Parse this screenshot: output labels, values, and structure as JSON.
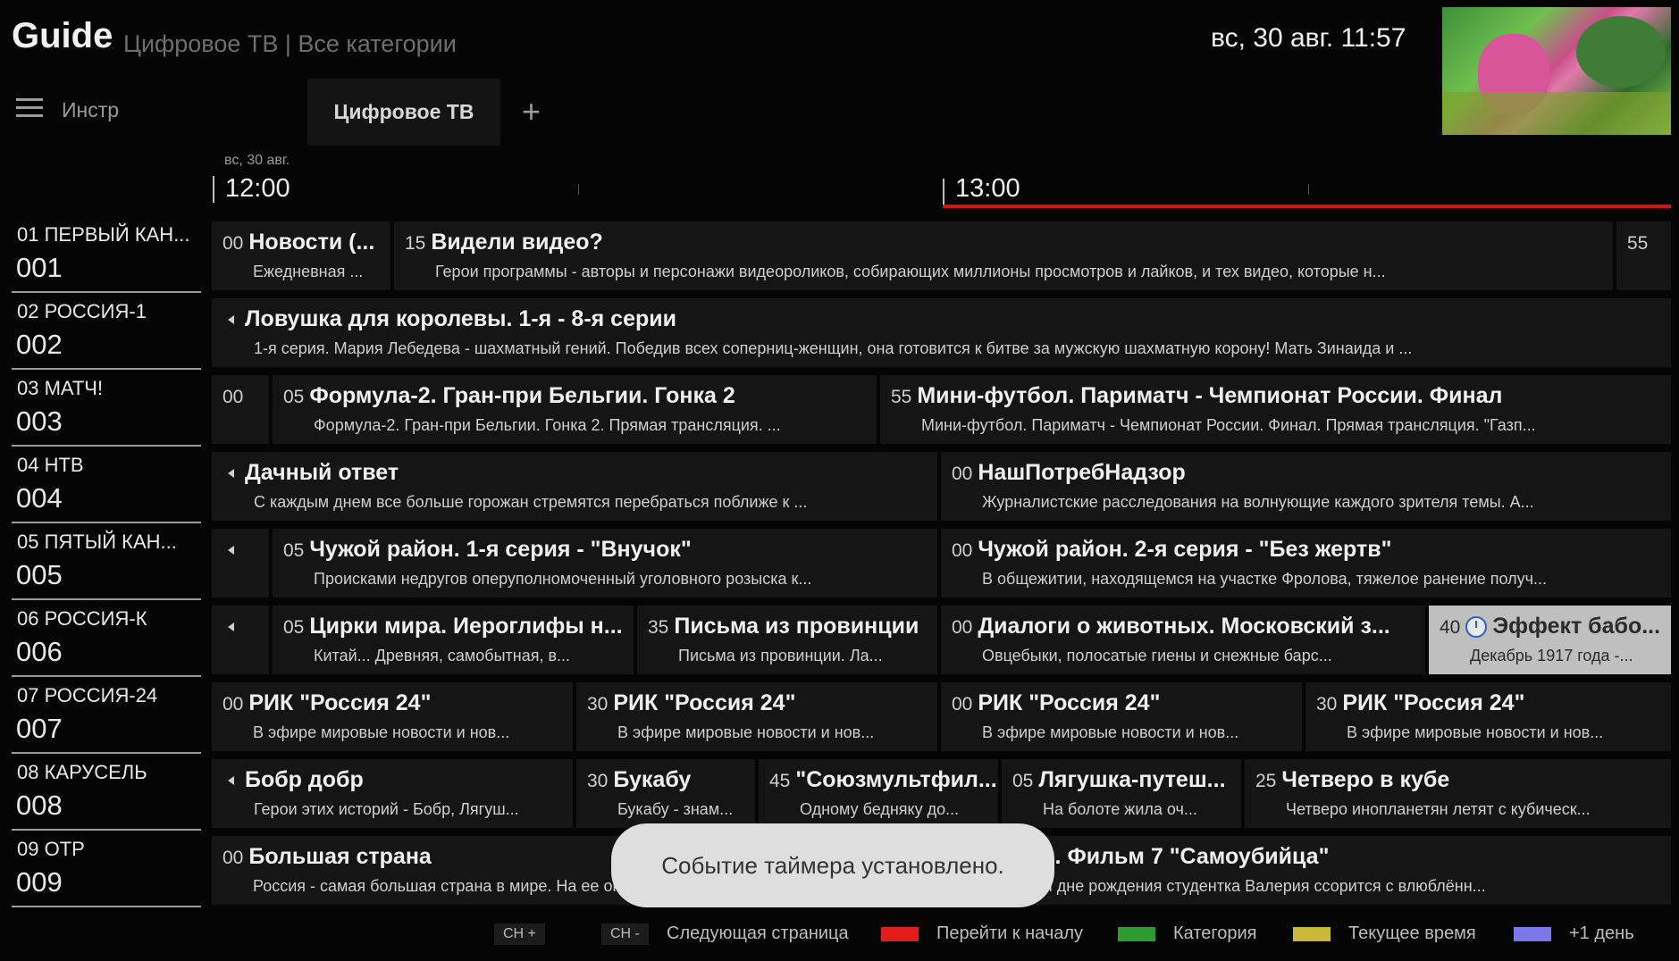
{
  "header": {
    "title": "Guide",
    "subtitle": "Цифровое ТВ | Все категории",
    "datetime": "вс, 30 авг. 11:57"
  },
  "toolbar": {
    "tools_label": "Инстр",
    "tab_label": "Цифровое ТВ",
    "add_label": "+"
  },
  "timeline": {
    "date": "вс, 30 авг.",
    "times": [
      "12:00",
      "13:00"
    ]
  },
  "channels": [
    {
      "name": "01 ПЕРВЫЙ КАН...",
      "number": "001"
    },
    {
      "name": "02 РОССИЯ-1",
      "number": "002"
    },
    {
      "name": "03 МАТЧ!",
      "number": "003"
    },
    {
      "name": "04 НТВ",
      "number": "004"
    },
    {
      "name": "05 ПЯТЫЙ КАН...",
      "number": "005"
    },
    {
      "name": "06 РОССИЯ-К",
      "number": "006"
    },
    {
      "name": "07 РОССИЯ-24",
      "number": "007"
    },
    {
      "name": "08 КАРУСЕЛЬ",
      "number": "008"
    },
    {
      "name": "09 ОТР",
      "number": "009"
    }
  ],
  "programs": {
    "r1": [
      {
        "minute": "00",
        "title": "Новости (...",
        "desc": "Ежедневная ..."
      },
      {
        "minute": "15",
        "title": "Видели видео?",
        "desc": "Герои программы - авторы и персонажи видеороликов, собирающих миллионы просмотров и лайков, и тех видео, которые н..."
      },
      {
        "minute": "55",
        "title": "",
        "desc": ""
      }
    ],
    "r2": [
      {
        "minute": "",
        "title": "Ловушка для королевы. 1-я - 8-я серии",
        "desc": "1-я серия. Мария Лебедева - шахматный гений. Победив всех соперниц-женщин, она готовится к битве за мужскую шахматную корону! Мать Зинаида и ..."
      }
    ],
    "r3": [
      {
        "minute": "00",
        "title": "",
        "desc": ""
      },
      {
        "minute": "05",
        "title": "Формула-2. Гран-при Бельгии. Гонка 2",
        "desc": "Формула-2. Гран-при Бельгии. Гонка 2. Прямая трансляция. ..."
      },
      {
        "minute": "55",
        "title": "Мини-футбол. Париматч - Чемпионат России. Финал",
        "desc": "Мини-футбол. Париматч - Чемпионат России. Финал. Прямая трансляция. \"Газп..."
      }
    ],
    "r4": [
      {
        "minute": "",
        "title": "Дачный ответ",
        "desc": "С каждым днем все больше горожан стремятся перебраться поближе к ..."
      },
      {
        "minute": "00",
        "title": "НашПотребНадзор",
        "desc": "Журналистские расследования на волнующие каждого зрителя темы. А..."
      }
    ],
    "r5": [
      {
        "minute": "",
        "title": "",
        "desc": ""
      },
      {
        "minute": "05",
        "title": "Чужой район. 1-я серия - \"Внучок\"",
        "desc": "Происками недругов оперуполномоченный уголовного розыска к..."
      },
      {
        "minute": "00",
        "title": "Чужой район. 2-я серия - \"Без жертв\"",
        "desc": "В общежитии, находящемся на участке Фролова, тяжелое ранение получ..."
      }
    ],
    "r6": [
      {
        "minute": "",
        "title": "",
        "desc": ""
      },
      {
        "minute": "05",
        "title": "Цирки мира. Иероглифы н...",
        "desc": "Китай... Древняя, самобытная, в..."
      },
      {
        "minute": "35",
        "title": "Письма из провинции",
        "desc": "Письма из провинции. Ла..."
      },
      {
        "minute": "00",
        "title": "Диалоги о животных. Московский з...",
        "desc": "Овцебыки, полосатые гиены и снежные барс..."
      },
      {
        "minute": "40",
        "title": "Эффект бабо...",
        "desc": "Декабрь 1917 года -..."
      }
    ],
    "r7": [
      {
        "minute": "00",
        "title": "РИК \"Россия 24\"",
        "desc": "В эфире мировые новости и нов..."
      },
      {
        "minute": "30",
        "title": "РИК \"Россия 24\"",
        "desc": "В эфире мировые новости и нов..."
      },
      {
        "minute": "00",
        "title": "РИК \"Россия 24\"",
        "desc": "В эфире мировые новости и нов..."
      },
      {
        "minute": "30",
        "title": "РИК \"Россия 24\"",
        "desc": "В эфире мировые новости и нов..."
      }
    ],
    "r8": [
      {
        "minute": "",
        "title": "Бобр добр",
        "desc": "Герои этих историй - Бобр, Лягуш..."
      },
      {
        "minute": "30",
        "title": "Букабу",
        "desc": "Букабу - знам..."
      },
      {
        "minute": "45",
        "title": "\"Союзмультфил...",
        "desc": "Одному бедняку до..."
      },
      {
        "minute": "05",
        "title": "Лягушка-путеш...",
        "desc": "На болоте жила оч..."
      },
      {
        "minute": "25",
        "title": "Четверо в кубе",
        "desc": "Четверо инопланетян летят с кубическ..."
      }
    ],
    "r9": [
      {
        "minute": "00",
        "title": "Большая страна",
        "desc": "Россия - самая большая страна в мире. На ее огромной территории расп..."
      },
      {
        "minute": "05",
        "title": "Шаман. Фильм 7 \"Самоубийца\"",
        "desc": "На своём дне рождения студентка Валерия ссорится с влюблённ..."
      }
    ]
  },
  "toast": "Событие таймера установлено.",
  "footer": {
    "ch_plus": "CH +",
    "ch_minus": "CH -",
    "next_page": "Следующая страница",
    "red_label": "Перейти к началу",
    "green_label": "Категория",
    "yellow_label": "Текущее время",
    "blue_label": "+1 день"
  },
  "colors": {
    "red": "#e11c1c",
    "green": "#2f9a34",
    "yellow": "#c9b83a",
    "blue": "#7a78e8",
    "now_line": "#d01818"
  }
}
